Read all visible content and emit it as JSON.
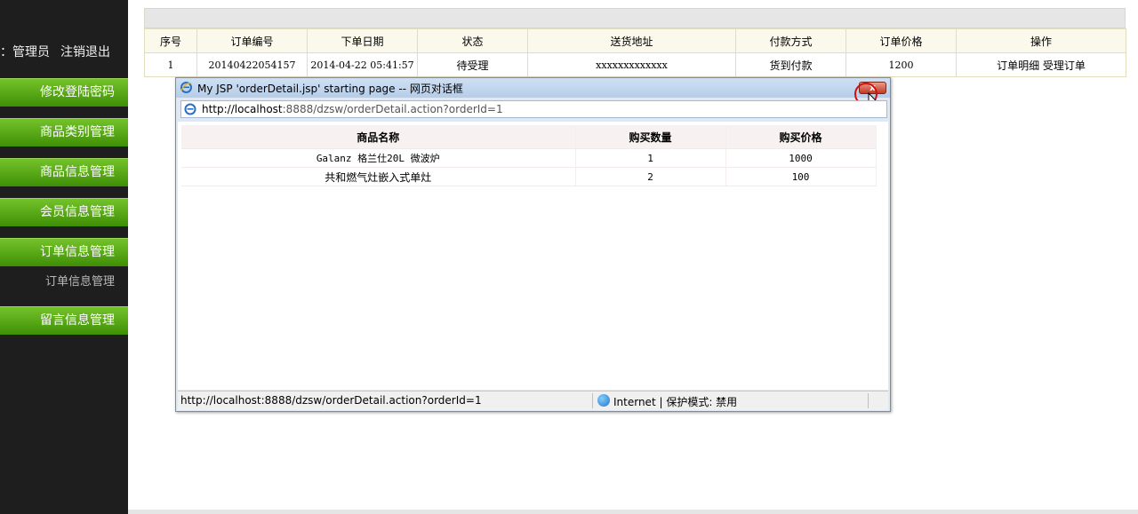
{
  "sidebar": {
    "user_role": "：管理员",
    "logout": "注销退出",
    "menu": [
      {
        "label": "修改登陆密码"
      },
      {
        "label": "商品类别管理"
      },
      {
        "label": "商品信息管理"
      },
      {
        "label": "会员信息管理"
      },
      {
        "label": "订单信息管理"
      },
      {
        "label": "留言信息管理"
      }
    ],
    "submenu_order": "订单信息管理"
  },
  "orders": {
    "headers": [
      "序号",
      "订单编号",
      "下单日期",
      "状态",
      "送货地址",
      "付款方式",
      "订单价格",
      "操作"
    ],
    "rows": [
      {
        "index": "1",
        "order_no": "20140422054157",
        "date": "2014-04-22 05:41:57",
        "status": "待受理",
        "address": "xxxxxxxxxxxxx",
        "payment": "货到付款",
        "price": "1200",
        "action_detail": "订单明细",
        "action_accept": "受理订单"
      }
    ]
  },
  "dialog": {
    "title": "My JSP 'orderDetail.jsp' starting page -- 网页对话框",
    "close_label": "x",
    "address_host": "http://localhost",
    "address_rest": ":8888/dzsw/orderDetail.action?orderId=1",
    "detail_headers": [
      "商品名称",
      "购买数量",
      "购买价格"
    ],
    "detail_rows": [
      {
        "name": "Galanz 格兰仕20L 微波炉",
        "qty": "1",
        "price": "1000"
      },
      {
        "name": "共和燃气灶嵌入式单灶",
        "qty": "2",
        "price": "100"
      }
    ],
    "status_url": "http://localhost:8888/dzsw/orderDetail.action?orderId=1",
    "status_zone": "Internet | 保护模式: 禁用"
  },
  "colors": {
    "sidebar_bg": "#1e1e1e",
    "menu_green": "#5aa818",
    "dialog_title": "#c4d7ee",
    "close_red": "#c23a23"
  }
}
